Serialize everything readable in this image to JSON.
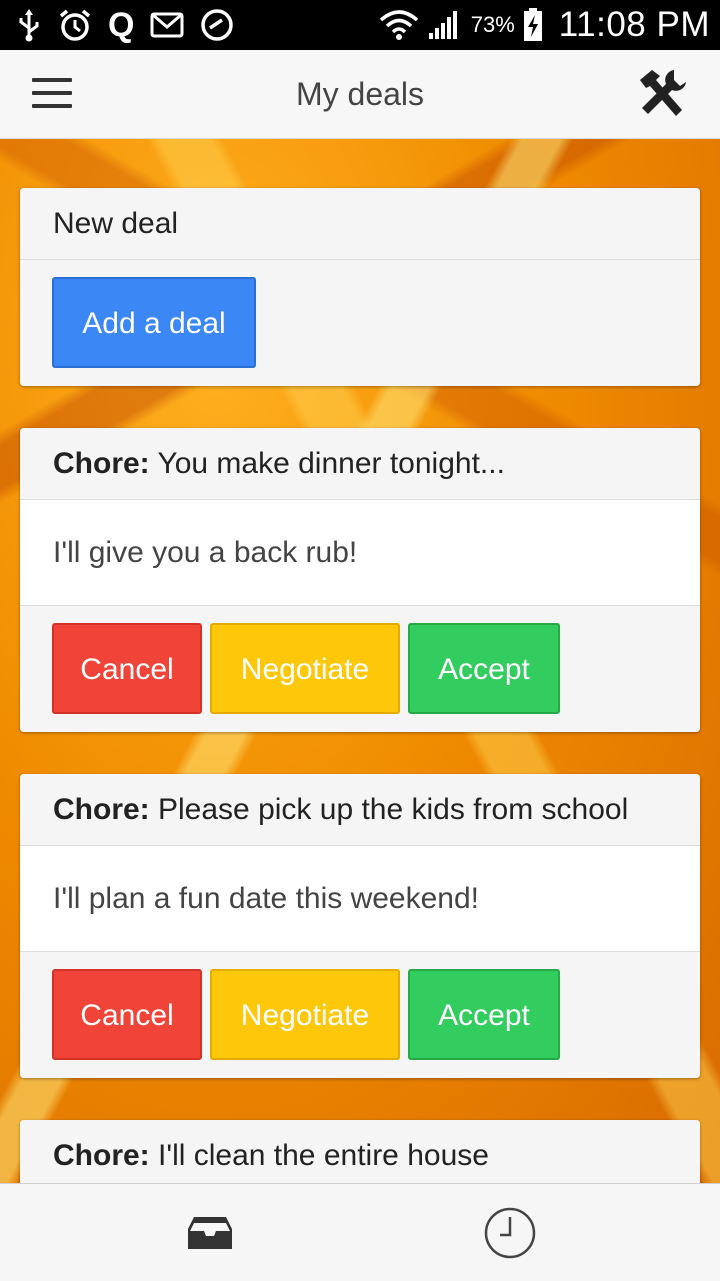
{
  "status_bar": {
    "icons_left": [
      "usb-icon",
      "alarm-icon",
      "quora-icon",
      "gmail-icon",
      "speedometer-icon"
    ],
    "icons_right": [
      "wifi-icon",
      "signal-icon",
      "battery-charging-icon"
    ],
    "quora_letter": "Q",
    "battery_percent": "73%",
    "time": "11:08 PM"
  },
  "app_bar": {
    "title": "My deals",
    "menu_icon": "hamburger-menu-icon",
    "tools_icon": "tools-icon"
  },
  "new_deal_card": {
    "header": "New deal",
    "button_label": "Add a deal",
    "button_color": "#3a87f5"
  },
  "deals": [
    {
      "chore_label": "Chore:",
      "chore_text": " You make dinner tonight...",
      "offer": "I'll give you a back rub!",
      "actions": {
        "cancel": "Cancel",
        "negotiate": "Negotiate",
        "accept": "Accept"
      }
    },
    {
      "chore_label": "Chore:",
      "chore_text": " Please pick up the kids from school",
      "offer": "I'll plan a fun date this weekend!",
      "actions": {
        "cancel": "Cancel",
        "negotiate": "Negotiate",
        "accept": "Accept"
      }
    },
    {
      "chore_label": "Chore:",
      "chore_text": " I'll clean the entire house"
    }
  ],
  "colors": {
    "cancel": "#ef4437",
    "negotiate": "#fdc70a",
    "accept": "#33cc5f"
  },
  "bottom_nav": {
    "items": [
      {
        "icon": "inbox-icon"
      },
      {
        "icon": "clock-icon"
      }
    ]
  }
}
